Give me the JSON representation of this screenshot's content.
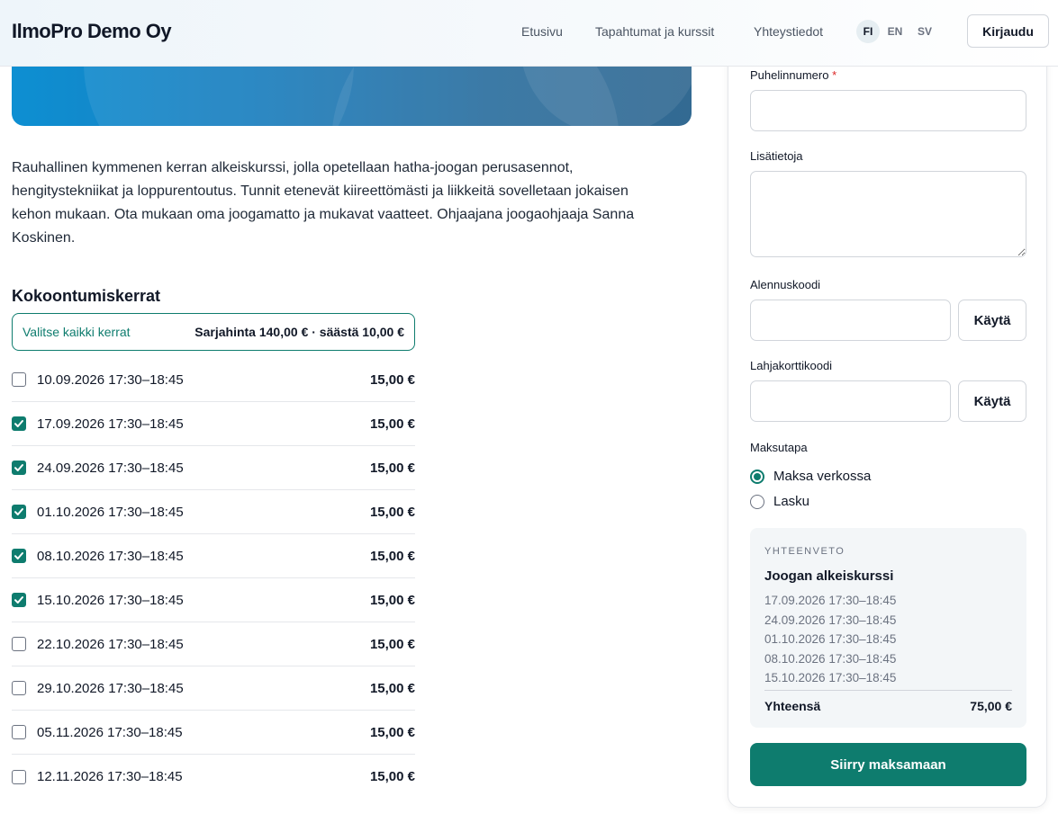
{
  "header": {
    "brand": "IlmoPro Demo Oy",
    "nav": [
      "Etusivu",
      "Tapahtumat ja kurssit",
      "Yhteystiedot"
    ],
    "languages": [
      {
        "code": "FI",
        "active": true
      },
      {
        "code": "EN",
        "active": false
      },
      {
        "code": "SV",
        "active": false
      }
    ],
    "login_label": "Kirjaudu"
  },
  "event": {
    "description": "Rauhallinen kymmenen kerran alkeiskurssi, jolla opetellaan hatha-joogan perusasennot, hengitystekniikat ja loppurentoutus. Tunnit etenevät kiireettömästi ja liikkeitä sovelletaan jokaisen kehon mukaan. Ota mukaan oma joogamatto ja mukavat vaatteet. Ohjaajana joogaohjaaja Sanna Koskinen."
  },
  "sessions_section": {
    "title": "Kokoontumiskerrat",
    "select_all_label": "Valitse kaikki kerrat",
    "series_price": "Sarjahinta 140,00 € · säästä 10,00 €",
    "sessions": [
      {
        "date": "10.09.2026 17:30–18:45",
        "price": "15,00 €",
        "checked": false
      },
      {
        "date": "17.09.2026 17:30–18:45",
        "price": "15,00 €",
        "checked": true
      },
      {
        "date": "24.09.2026 17:30–18:45",
        "price": "15,00 €",
        "checked": true
      },
      {
        "date": "01.10.2026 17:30–18:45",
        "price": "15,00 €",
        "checked": true
      },
      {
        "date": "08.10.2026 17:30–18:45",
        "price": "15,00 €",
        "checked": true
      },
      {
        "date": "15.10.2026 17:30–18:45",
        "price": "15,00 €",
        "checked": true
      },
      {
        "date": "22.10.2026 17:30–18:45",
        "price": "15,00 €",
        "checked": false
      },
      {
        "date": "29.10.2026 17:30–18:45",
        "price": "15,00 €",
        "checked": false
      },
      {
        "date": "05.11.2026 17:30–18:45",
        "price": "15,00 €",
        "checked": false
      },
      {
        "date": "12.11.2026 17:30–18:45",
        "price": "15,00 €",
        "checked": false
      }
    ]
  },
  "form": {
    "phone_label": "Puhelinnumero",
    "required_mark": "*",
    "phone_value": "",
    "notes_label": "Lisätietoja",
    "notes_value": "",
    "discount_label": "Alennuskoodi",
    "discount_value": "",
    "giftcard_label": "Lahjakorttikoodi",
    "giftcard_value": "",
    "apply_label": "Käytä",
    "payment_label": "Maksutapa",
    "payment_options": [
      {
        "label": "Maksa verkossa",
        "selected": true
      },
      {
        "label": "Lasku",
        "selected": false
      }
    ],
    "submit_label": "Siirry maksamaan"
  },
  "summary": {
    "heading": "YHTEENVETO",
    "title": "Joogan alkeiskurssi",
    "items": [
      "17.09.2026 17:30–18:45",
      "24.09.2026 17:30–18:45",
      "01.10.2026 17:30–18:45",
      "08.10.2026 17:30–18:45",
      "15.10.2026 17:30–18:45"
    ],
    "total_label": "Yhteensä",
    "total_value": "75,00 €"
  },
  "colors": {
    "accent": "#0e7c6e",
    "required": "#dc2626"
  }
}
